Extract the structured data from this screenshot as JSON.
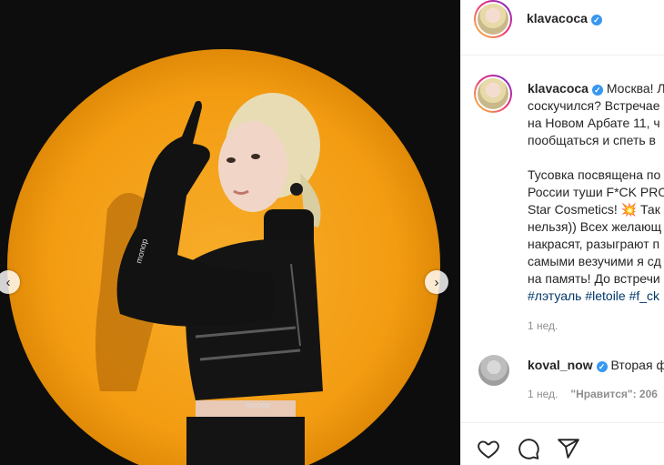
{
  "post": {
    "photo": {
      "subject": "woman in black outfit against orange spotlight",
      "backdrop_color": "#f39c12",
      "background_color": "#0d0d0d",
      "prev_icon": "chevron-left-icon",
      "next_icon": "chevron-right-icon",
      "prev_glyph": "‹",
      "next_glyph": "›"
    },
    "header": {
      "username": "klavacoca",
      "verified_glyph": "✓"
    },
    "caption": {
      "username": "klavacoca",
      "verified_glyph": "✓",
      "lines": [
        "Москва! Л",
        "соскучился? Встречае",
        "на Новом Арбате 11, ч",
        "пообщаться и спеть в"
      ],
      "lines2": [
        "Тусовка посвящена по",
        "России туши F*CK PRO",
        "Star Cosmetics! 💥 Так",
        "нельзя)) Всех желающ",
        "накрасят, разыграют п",
        "самыми везучими я сд",
        "на память! До встречи"
      ],
      "hashtags": "#лэтуаль #letoile #f_ck",
      "time": "1 нед."
    },
    "comment": {
      "username": "koval_now",
      "verified_glyph": "✓",
      "text": "Вторая ф",
      "time": "1 нед.",
      "likes": "\"Нравится\": 206"
    },
    "actions": {
      "like_icon": "heart-icon",
      "comment_icon": "comment-icon",
      "share_icon": "share-icon"
    },
    "colors": {
      "verified": "#3897f0",
      "hashtag": "#00376b",
      "muted": "#8e8e8e"
    }
  }
}
